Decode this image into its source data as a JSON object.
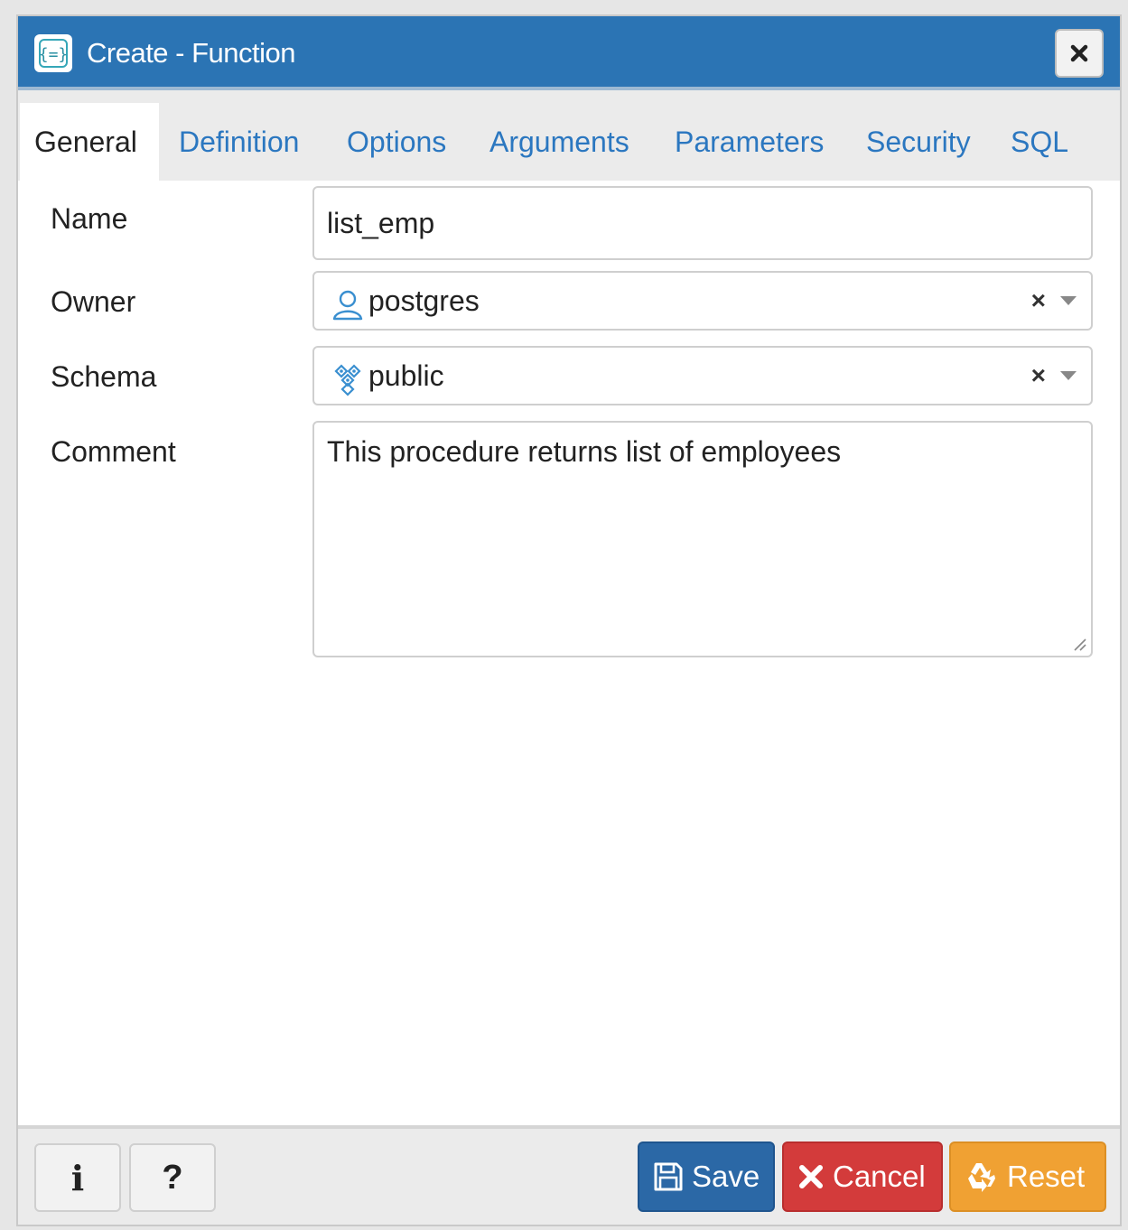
{
  "dialog": {
    "title": "Create - Function",
    "close_icon": "close-icon"
  },
  "tabs": [
    {
      "label": "General",
      "active": true
    },
    {
      "label": "Definition",
      "active": false
    },
    {
      "label": "Options",
      "active": false
    },
    {
      "label": "Arguments",
      "active": false
    },
    {
      "label": "Parameters",
      "active": false
    },
    {
      "label": "Security",
      "active": false
    },
    {
      "label": "SQL",
      "active": false
    }
  ],
  "form": {
    "name": {
      "label": "Name",
      "value": "list_emp"
    },
    "owner": {
      "label": "Owner",
      "value": "postgres",
      "icon": "user-icon",
      "clear": "×"
    },
    "schema": {
      "label": "Schema",
      "value": "public",
      "icon": "schema-icon",
      "clear": "×"
    },
    "comment": {
      "label": "Comment",
      "value": "This procedure returns list of employees"
    }
  },
  "footer": {
    "info_label": "i",
    "help_label": "?",
    "save_label": "Save",
    "cancel_label": "Cancel",
    "reset_label": "Reset"
  },
  "colors": {
    "titlebar": "#2b74b4",
    "tab_link": "#2b77c0",
    "save": "#2b68a6",
    "cancel": "#d33b3b",
    "reset": "#f0a133"
  }
}
